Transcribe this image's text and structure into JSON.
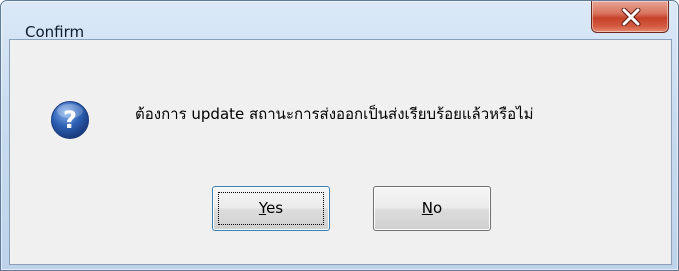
{
  "window": {
    "title": "Confirm"
  },
  "dialog": {
    "icon": "question-icon",
    "message": "ต้องการ update สถานะการส่งออกเป็นส่งเรียบร้อยแล้วหรือไม่",
    "yes_mnemonic": "Y",
    "yes_rest": "es",
    "no_mnemonic": "N",
    "no_rest": "o"
  },
  "colors": {
    "close_button": "#c5412a",
    "icon_blue": "#2c5fb4"
  }
}
